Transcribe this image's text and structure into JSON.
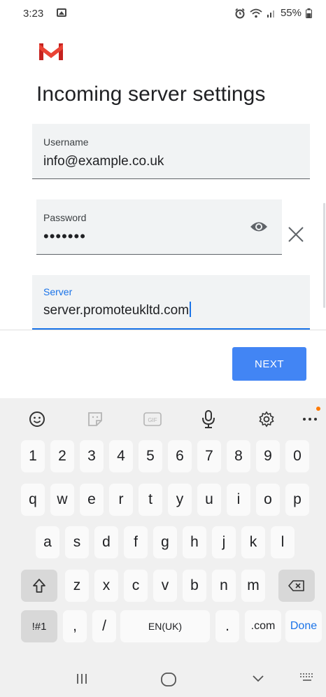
{
  "status_bar": {
    "time": "3:23",
    "battery": "55%"
  },
  "app": {
    "logo": "gmail-logo",
    "title": "Incoming server settings"
  },
  "form": {
    "username": {
      "label": "Username",
      "value": "info@example.co.uk"
    },
    "password": {
      "label": "Password",
      "value": "•••••••"
    },
    "server": {
      "label": "Server",
      "value": "server.promoteukltd.com"
    }
  },
  "actions": {
    "next_label": "NEXT"
  },
  "keyboard": {
    "toolbar_icons": [
      "emoji-icon",
      "sticker-icon",
      "gif-icon",
      "microphone-icon",
      "settings-icon",
      "more-icon"
    ],
    "gif_label": "GIF",
    "number_row": [
      "1",
      "2",
      "3",
      "4",
      "5",
      "6",
      "7",
      "8",
      "9",
      "0"
    ],
    "row1": [
      "q",
      "w",
      "e",
      "r",
      "t",
      "y",
      "u",
      "i",
      "o",
      "p"
    ],
    "row2": [
      "a",
      "s",
      "d",
      "f",
      "g",
      "h",
      "j",
      "k",
      "l"
    ],
    "row3": [
      "z",
      "x",
      "c",
      "v",
      "b",
      "n",
      "m"
    ],
    "bottom": {
      "symbols": "!#1",
      "comma": ",",
      "slash": "/",
      "space": "EN(UK)",
      "period": ".",
      "dotcom": ".com",
      "done": "Done"
    }
  },
  "nav_bar": {
    "items": [
      "recents-icon",
      "home-icon",
      "back-icon",
      "keyboard-icon"
    ]
  },
  "colors": {
    "accent": "#1a73e8",
    "button": "#4285f4",
    "field_bg": "#f1f3f4",
    "keyboard_bg": "#f0f0f0"
  }
}
